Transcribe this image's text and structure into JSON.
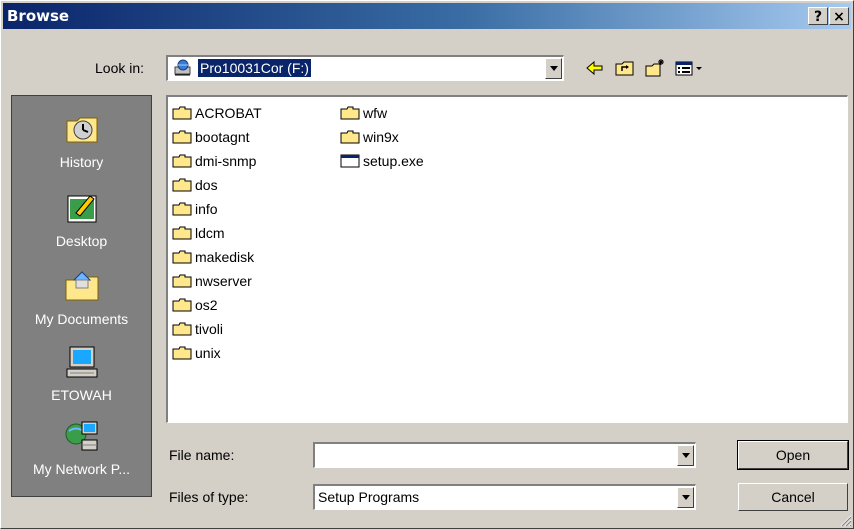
{
  "window": {
    "title": "Browse",
    "help_label": "?",
    "close_label": "×"
  },
  "lookin": {
    "label": "Look in:",
    "value": "Pro10031Cor (F:)",
    "icon": "network-drive-icon"
  },
  "toolbar": {
    "back": "back-arrow-icon",
    "up": "up-folder-icon",
    "new_folder": "new-folder-icon",
    "view": "view-menu-icon"
  },
  "places": [
    {
      "label": "History",
      "icon": "history-icon"
    },
    {
      "label": "Desktop",
      "icon": "desktop-icon"
    },
    {
      "label": "My Documents",
      "icon": "my-documents-icon"
    },
    {
      "label": "ETOWAH",
      "icon": "my-computer-icon"
    },
    {
      "label": "My Network P...",
      "icon": "network-places-icon"
    }
  ],
  "files": {
    "col1": [
      "ACROBAT",
      "bootagnt",
      "dmi-snmp",
      "dos",
      "info",
      "ldcm",
      "makedisk",
      "nwserver",
      "os2",
      "tivoli",
      "unix"
    ],
    "col2": [
      {
        "name": "wfw",
        "type": "folder"
      },
      {
        "name": "win9x",
        "type": "folder"
      },
      {
        "name": "setup.exe",
        "type": "exe"
      }
    ]
  },
  "filename": {
    "label": "File name:",
    "value": ""
  },
  "filetype": {
    "label": "Files of type:",
    "value": "Setup Programs"
  },
  "buttons": {
    "open": "Open",
    "cancel": "Cancel"
  },
  "colors": {
    "title_start": "#0a246a",
    "title_end": "#a6caf0",
    "face": "#d4d0c8",
    "selection": "#0a246a",
    "places_bg": "#808080",
    "folder": "#ffe88c"
  }
}
